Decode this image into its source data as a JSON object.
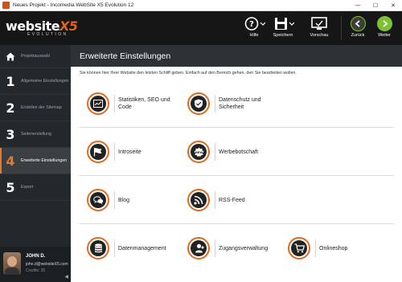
{
  "window": {
    "title": "Neues Projekt - Incomedia WebSite X5 Evolution 12"
  },
  "logo": {
    "word": "website",
    "x5": "X5",
    "edition": "EVOLUTION"
  },
  "toolbar": {
    "help": "Hilfe",
    "save": "Speichern",
    "preview": "Vorschau",
    "back": "Zurück",
    "next": "Weiter"
  },
  "sidebar": {
    "steps": [
      {
        "num": "",
        "label": "Projektauswahl"
      },
      {
        "num": "1",
        "label": "Allgemeine Einstellungen"
      },
      {
        "num": "2",
        "label": "Erstellen der Sitemap"
      },
      {
        "num": "3",
        "label": "Seitenerstellung"
      },
      {
        "num": "4",
        "label": "Erweiterte Einstellungen"
      },
      {
        "num": "5",
        "label": "Export"
      }
    ],
    "user": {
      "name": "JOHN D.",
      "email": "john.d@websiteX5.com",
      "credits": "Credits: 35"
    }
  },
  "main": {
    "title": "Erweiterte Einstellungen",
    "intro": "Sie können hier Ihrer Website den letzten Schliff geben. Einfach auf den Bereich gehen, den Sie bearbeiten wollen.",
    "items": [
      {
        "label": "Statistiken, SEO und Code",
        "icon": "statistics-icon"
      },
      {
        "label": "Datenschutz und Sicherheit",
        "icon": "shield-icon"
      },
      {
        "label": "Introseite",
        "icon": "flag-icon"
      },
      {
        "label": "Werbebotschaft",
        "icon": "new-badge-icon"
      },
      {
        "label": "Blog",
        "icon": "chat-bubbles-icon"
      },
      {
        "label": "RSS-Feed",
        "icon": "rss-icon"
      },
      {
        "label": "Datenmanagement",
        "icon": "database-icon"
      },
      {
        "label": "Zugangsverwaltung",
        "icon": "users-icon"
      },
      {
        "label": "Onlineshop",
        "icon": "cart-icon"
      }
    ]
  },
  "colors": {
    "accent": "#e06a1f",
    "nav_green": "#7ec234",
    "header": "#161616",
    "sidebar": "#23282d"
  }
}
